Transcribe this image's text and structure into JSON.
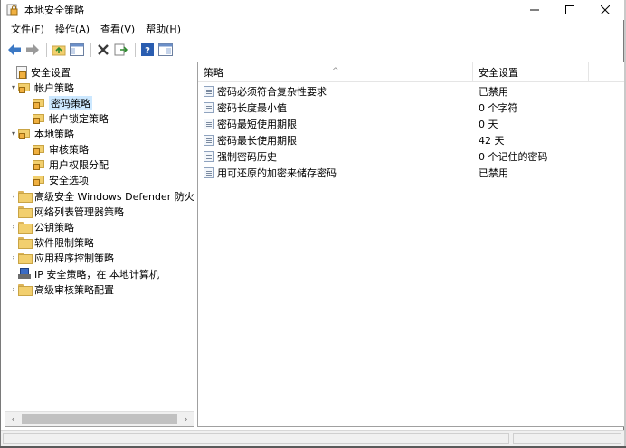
{
  "window": {
    "title": "本地安全策略",
    "minimize_glyph": "—",
    "maximize_glyph": "☐",
    "close_glyph": "✕"
  },
  "menu": [
    {
      "label": "文件(F)"
    },
    {
      "label": "操作(A)"
    },
    {
      "label": "查看(V)"
    },
    {
      "label": "帮助(H)"
    }
  ],
  "toolbar": {
    "icons": [
      "back-arrow-icon",
      "forward-arrow-icon",
      "up-folder-icon",
      "show-hide-tree-icon",
      "delete-icon",
      "export-list-icon",
      "help-icon",
      "properties-icon"
    ],
    "colors": {
      "arrow": "#3b78c4",
      "delete": "#3a3a3a",
      "help": "#2a5db0"
    }
  },
  "tree": {
    "items": [
      {
        "label": "安全设置",
        "icon": "security-settings-icon",
        "expander": ""
      },
      {
        "label": "帐户策略",
        "icon": "lock-folder-icon",
        "expander": "open"
      },
      {
        "label": "密码策略",
        "icon": "lock-folder-icon",
        "expander": "",
        "selected": true
      },
      {
        "label": "帐户锁定策略",
        "icon": "lock-folder-icon",
        "expander": ""
      },
      {
        "label": "本地策略",
        "icon": "lock-folder-icon",
        "expander": "open"
      },
      {
        "label": "审核策略",
        "icon": "lock-folder-icon",
        "expander": ""
      },
      {
        "label": "用户权限分配",
        "icon": "lock-folder-icon",
        "expander": ""
      },
      {
        "label": "安全选项",
        "icon": "lock-folder-icon",
        "expander": ""
      },
      {
        "label": "高级安全 Windows Defender 防火墙",
        "icon": "folder-icon",
        "expander": "closed"
      },
      {
        "label": "网络列表管理器策略",
        "icon": "folder-icon",
        "expander": ""
      },
      {
        "label": "公钥策略",
        "icon": "folder-icon",
        "expander": "closed"
      },
      {
        "label": "软件限制策略",
        "icon": "folder-icon",
        "expander": ""
      },
      {
        "label": "应用程序控制策略",
        "icon": "folder-icon",
        "expander": "closed"
      },
      {
        "label": "IP 安全策略，在 本地计算机",
        "icon": "ip-security-icon",
        "expander": ""
      },
      {
        "label": "高级审核策略配置",
        "icon": "folder-icon",
        "expander": "closed"
      }
    ]
  },
  "list": {
    "columns": [
      "策略",
      "安全设置"
    ],
    "rows": [
      {
        "policy": "密码必须符合复杂性要求",
        "setting": "已禁用"
      },
      {
        "policy": "密码长度最小值",
        "setting": "0 个字符"
      },
      {
        "policy": "密码最短使用期限",
        "setting": "0 天"
      },
      {
        "policy": "密码最长使用期限",
        "setting": "42 天"
      },
      {
        "policy": "强制密码历史",
        "setting": "0 个记住的密码"
      },
      {
        "policy": "用可还原的加密来储存密码",
        "setting": "已禁用"
      }
    ]
  },
  "glyphs": {
    "expander_open": "▾",
    "expander_closed": "›",
    "sort_up": "^",
    "scroll_left": "‹",
    "scroll_right": "›"
  }
}
